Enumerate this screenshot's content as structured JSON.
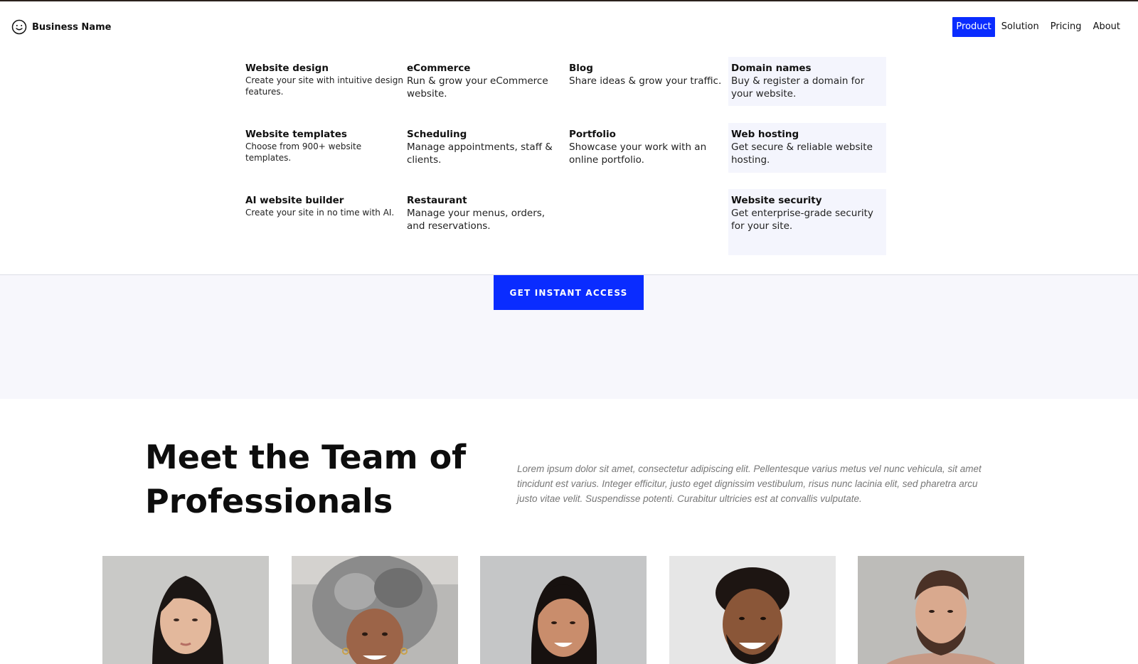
{
  "header": {
    "brand_name": "Business Name",
    "brand_icon": "smiley-icon",
    "nav": [
      {
        "label": "Product",
        "active": true
      },
      {
        "label": "Solution",
        "active": false
      },
      {
        "label": "Pricing",
        "active": false
      },
      {
        "label": "About",
        "active": false
      }
    ]
  },
  "menu": {
    "columns": [
      [
        {
          "title": "Website design",
          "desc": "Create your site with intuitive design features."
        },
        {
          "title": "Website templates",
          "desc": "Choose from 900+ website templates."
        },
        {
          "title": "AI website builder",
          "desc": "Create your site in no time with AI."
        }
      ],
      [
        {
          "title": "eCommerce",
          "desc": "Run & grow your eCommerce website."
        },
        {
          "title": "Scheduling",
          "desc": "Manage appointments, staff & clients."
        },
        {
          "title": "Restaurant",
          "desc": "Manage your menus, orders, and reservations."
        }
      ],
      [
        {
          "title": "Blog",
          "desc": "Share ideas & grow your traffic."
        },
        {
          "title": "Portfolio",
          "desc": "Showcase your work with an online portfolio."
        }
      ],
      [
        {
          "title": "Domain names",
          "desc": "Buy & register a domain for your website."
        },
        {
          "title": "Web hosting",
          "desc": "Get secure & reliable website hosting."
        },
        {
          "title": "Website security",
          "desc": "Get enterprise-grade security for your site."
        }
      ]
    ]
  },
  "hero": {
    "cta_label": "GET INSTANT ACCESS"
  },
  "team": {
    "title_line1": "Meet the Team of",
    "title_line2": "Professionals",
    "description": "Lorem ipsum dolor sit amet, consectetur adipiscing elit. Pellentesque varius metus vel nunc vehicula, sit amet tincidunt est varius. Integer efficitur, justo eget dignissim vestibulum, risus nunc lacinia elit, sed pharetra arcu justo vitae velit. Suspendisse potenti. Curabitur ultricies est at convallis vulputate.",
    "members": [
      {
        "photo": "team-member-1-photo"
      },
      {
        "photo": "team-member-2-photo"
      },
      {
        "photo": "team-member-3-photo"
      },
      {
        "photo": "team-member-4-photo"
      },
      {
        "photo": "team-member-5-photo"
      }
    ]
  },
  "colors": {
    "accent": "#0a2cff",
    "menu_highlight": "#f4f5fd",
    "hero_bg": "#f7f7fc"
  }
}
